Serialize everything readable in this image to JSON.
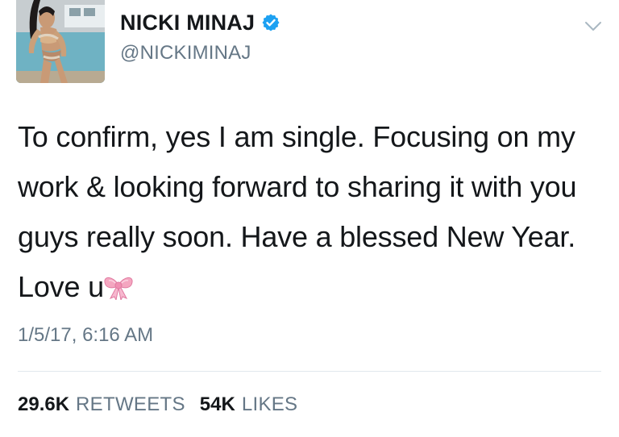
{
  "tweet": {
    "author_name": "NICKI MINAJ",
    "author_handle": "@NICKIMINAJ",
    "verified": true,
    "avatar_icon": "profile-photo",
    "menu_icon": "chevron-down-icon",
    "text": "To confirm, yes I am single. Focusing on my work & looking forward to sharing it with you guys really soon. Have a blessed New Year. Love u",
    "emoji": "ribbon-bow-emoji",
    "timestamp": "1/5/17, 6:16 AM",
    "retweets_count": "29.6K",
    "retweets_label": "RETWEETS",
    "likes_count": "54K",
    "likes_label": "LIKES"
  },
  "colors": {
    "text_primary": "#14171a",
    "text_secondary": "#657786",
    "verified_blue": "#1da1f2",
    "divider": "#e1e8ed",
    "bow_pink": "#f4a6c0"
  }
}
